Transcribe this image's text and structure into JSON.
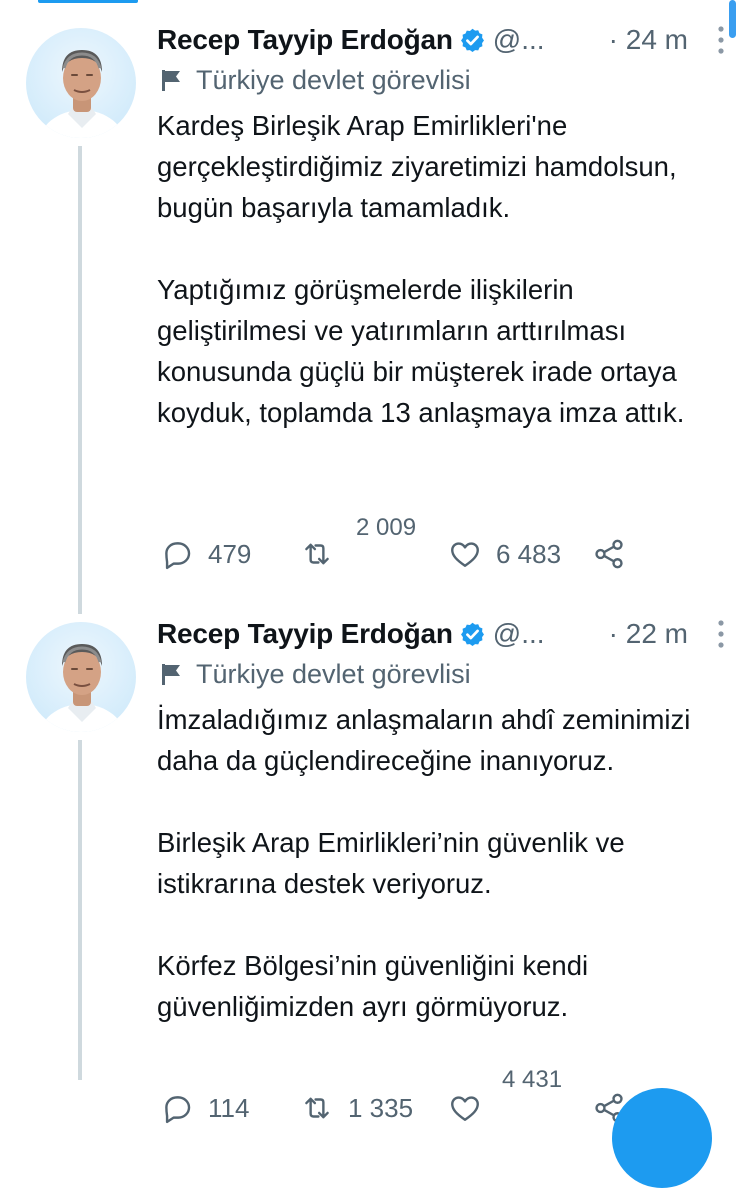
{
  "colors": {
    "accent": "#1d9bf0",
    "text": "#0f1419",
    "secondary": "#536471",
    "thread_line": "#cfd9de"
  },
  "tweets": [
    {
      "display_name": "Recep Tayyip Erdoğan",
      "handle": "@...",
      "time": "· 24 m",
      "label": "Türkiye devlet görevlisi",
      "paragraphs": [
        "Kardeş Birleşik Arap Emirlikleri'ne gerçekleştirdiğimiz ziyaretimizi hamdolsun, bugün başarıyla tamamladık.",
        "Yaptığımız görüşmelerde ilişkilerin geliştirilmesi ve yatırımların arttırılması konusunda güçlü bir müşterek irade ortaya koyduk, toplamda 13 anlaşmaya imza attık."
      ],
      "replies": "479",
      "retweets": "2 009",
      "likes": "6 483",
      "icons": [
        "verified-badge-icon",
        "flag-icon",
        "more-icon",
        "reply-icon",
        "retweet-icon",
        "like-icon",
        "share-icon"
      ]
    },
    {
      "display_name": "Recep Tayyip Erdoğan",
      "handle": "@...",
      "time": "· 22 m",
      "label": "Türkiye devlet görevlisi",
      "paragraphs": [
        "İmzaladığımız anlaşmaların ahdî zeminimizi daha da güçlendireceğine inanıyoruz.",
        "Birleşik Arap Emirlikleri’nin güvenlik ve istikrarına destek veriyoruz.",
        "Körfez Bölgesi’nin güvenliğini kendi güvenliğimizden ayrı görmüyoruz."
      ],
      "replies": "114",
      "retweets": "1 335",
      "likes": "4 431",
      "icons": [
        "verified-badge-icon",
        "flag-icon",
        "more-icon",
        "reply-icon",
        "retweet-icon",
        "like-icon",
        "share-icon"
      ]
    }
  ]
}
